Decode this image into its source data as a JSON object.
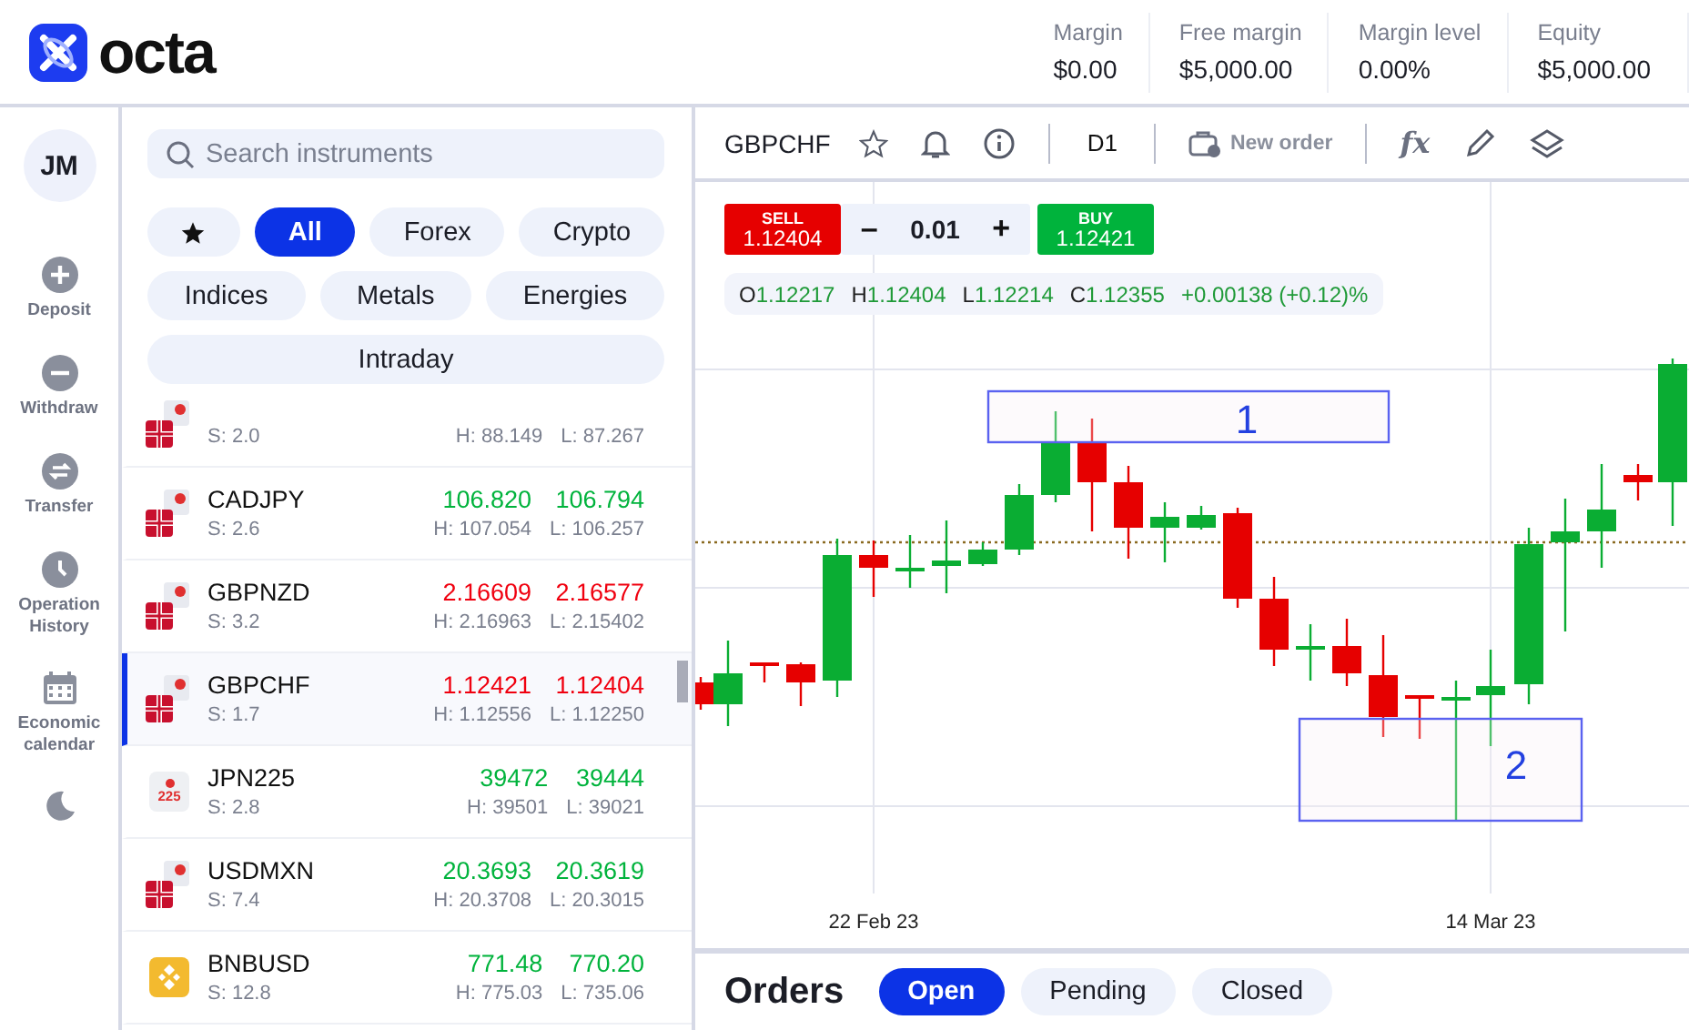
{
  "header": {
    "logo": "octa",
    "stats": [
      {
        "label": "Margin",
        "value": "$0.00"
      },
      {
        "label": "Free margin",
        "value": "$5,000.00"
      },
      {
        "label": "Margin level",
        "value": "0.00%"
      },
      {
        "label": "Equity",
        "value": "$5,000.00"
      }
    ]
  },
  "nav": {
    "avatar": "JM",
    "items": [
      {
        "kind": "plus",
        "label": "Deposit"
      },
      {
        "kind": "minus",
        "label": "Withdraw"
      },
      {
        "kind": "transfer",
        "label": "Transfer"
      },
      {
        "kind": "clock",
        "label": "Operation History"
      },
      {
        "kind": "calendar",
        "label": "Economic calendar"
      },
      {
        "kind": "moon"
      }
    ]
  },
  "search": {
    "placeholder": "Search instruments"
  },
  "filters": [
    [
      {
        "kind": "star",
        "selected": false
      },
      {
        "kind": "text",
        "label": "All",
        "selected": true
      },
      {
        "kind": "text",
        "label": "Forex",
        "selected": false
      },
      {
        "kind": "text",
        "label": "Crypto",
        "selected": false
      }
    ],
    [
      {
        "kind": "text",
        "label": "Indices",
        "selected": false
      },
      {
        "kind": "text",
        "label": "Metals",
        "selected": false
      },
      {
        "kind": "text",
        "label": "Energies",
        "selected": false
      }
    ],
    [
      {
        "kind": "text",
        "label": "Intraday",
        "selected": false
      }
    ]
  ],
  "instruments": [
    {
      "kind": "pair",
      "spread": "S: 2.0",
      "high": "H: 88.149",
      "low": "L: 87.267",
      "selected": false
    },
    {
      "kind": "pair",
      "name": "CADJPY",
      "spread": "S: 2.6",
      "bid": "106.820",
      "ask": "106.794",
      "high": "H: 107.054",
      "low": "L: 106.257",
      "color": "#00b33c",
      "selected": false
    },
    {
      "kind": "pair",
      "name": "GBPNZD",
      "spread": "S: 3.2",
      "bid": "2.16609",
      "ask": "2.16577",
      "high": "H: 2.16963",
      "low": "L: 2.15402",
      "color": "#f0000f",
      "selected": false
    },
    {
      "kind": "pair",
      "name": "GBPCHF",
      "spread": "S: 1.7",
      "bid": "1.12421",
      "ask": "1.12404",
      "high": "H: 1.12556",
      "low": "L: 1.12250",
      "color": "#f0000f",
      "selected": true
    },
    {
      "kind": "index",
      "icon_text": "225",
      "name": "JPN225",
      "spread": "S: 2.8",
      "bid": "39472",
      "ask": "39444",
      "high": "H: 39501",
      "low": "L: 39021",
      "color": "#00b33c",
      "selected": false
    },
    {
      "kind": "pair",
      "name": "USDMXN",
      "spread": "S: 7.4",
      "bid": "20.3693",
      "ask": "20.3619",
      "high": "H: 20.3708",
      "low": "L: 20.3015",
      "color": "#00b33c",
      "selected": false
    },
    {
      "kind": "coin",
      "name": "BNBUSD",
      "spread": "S: 12.8",
      "bid": "771.48",
      "ask": "770.20",
      "high": "H: 775.03",
      "low": "L: 735.06",
      "color": "#00b33c",
      "selected": false
    }
  ],
  "toolbar": {
    "symbol": "GBPCHF",
    "timeframe": "D1",
    "new_order": "New order",
    "fx": "fx"
  },
  "trade": {
    "sell_label": "SELL",
    "sell_price": "1.12404",
    "lot": "0.01",
    "minus": "–",
    "plus": "+",
    "buy_label": "BUY",
    "buy_price": "1.12421"
  },
  "ohlc": [
    {
      "key": "O",
      "value": "1.12217"
    },
    {
      "key": "H",
      "value": "1.12404"
    },
    {
      "key": "L",
      "value": "1.12214"
    },
    {
      "key": "C",
      "value": "1.12355"
    }
  ],
  "change": "+0.00138 (+0.12)%",
  "annotations": [
    "1",
    "2"
  ],
  "x_axis": [
    "22 Feb 23",
    "14 Mar 23"
  ],
  "orders": {
    "title": "Orders",
    "tabs": [
      {
        "label": "Open",
        "selected": true
      },
      {
        "label": "Pending",
        "selected": false
      },
      {
        "label": "Closed",
        "selected": false
      }
    ]
  }
}
